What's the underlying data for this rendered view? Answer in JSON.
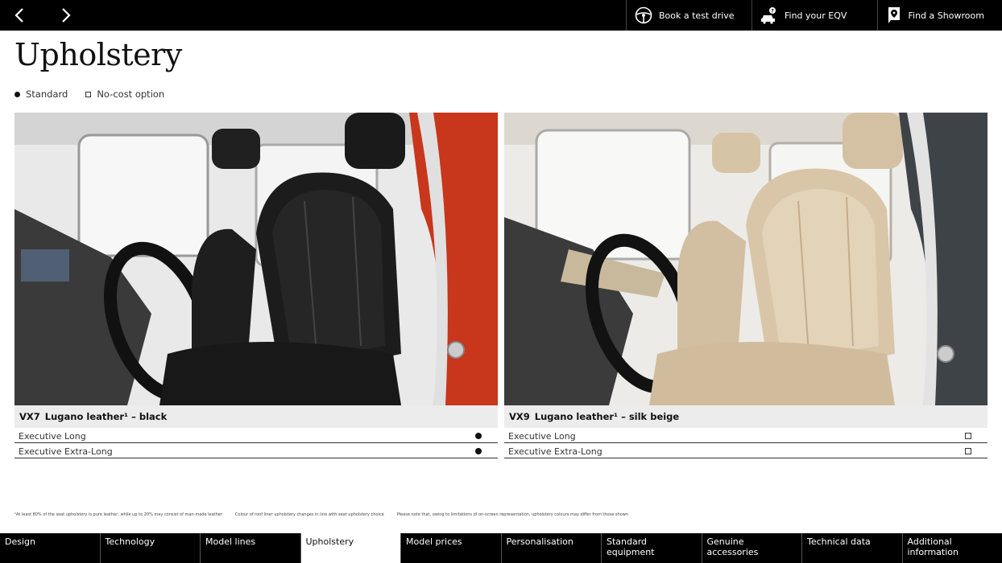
{
  "topbar": {
    "prev_icon": "chevron-left-icon",
    "next_icon": "chevron-right-icon",
    "actions": [
      {
        "label": "Book a test drive",
        "icon": "steering-wheel-icon"
      },
      {
        "label": "Find your EQV",
        "icon": "car-search-icon"
      },
      {
        "label": "Find a Showroom",
        "icon": "location-pin-icon"
      }
    ]
  },
  "page_title": "Upholstery",
  "legend": {
    "standard": "Standard",
    "no_cost_option": "No-cost option"
  },
  "cards": [
    {
      "code": "VX7",
      "name": "Lugano leather¹ – black",
      "photo_icon": "black-leather-seat-photo",
      "rows": [
        {
          "label": "Executive Long",
          "mark": "standard"
        },
        {
          "label": "Executive Extra-Long",
          "mark": "standard"
        }
      ]
    },
    {
      "code": "VX9",
      "name": "Lugano leather¹ – silk beige",
      "photo_icon": "beige-leather-seat-photo",
      "rows": [
        {
          "label": "Executive Long",
          "mark": "no-cost-option"
        },
        {
          "label": "Executive Extra-Long",
          "mark": "no-cost-option"
        }
      ]
    }
  ],
  "footnotes": [
    "¹At least 80% of the seat upholstery is pure leather, while up to 20% may consist of man-made leather",
    "Colour of roof liner upholstery changes in line with seat upholstery choice",
    "Please note that, owing to limitations of on-screen representation, upholstery colours may differ from those shown"
  ],
  "bottom_nav": {
    "active_index": 3,
    "tabs": [
      "Design",
      "Technology",
      "Model lines",
      "Upholstery",
      "Model prices",
      "Personalisation",
      "Standard equipment",
      "Genuine accessories",
      "Technical data",
      "Additional information"
    ]
  },
  "colors": {
    "bar": "#000000",
    "caption_bg": "#ececec",
    "red_car": "#c8361c",
    "grey_car": "#3e4348",
    "black_leather": "#1c1c1c",
    "beige_leather": "#d9c6a8"
  }
}
